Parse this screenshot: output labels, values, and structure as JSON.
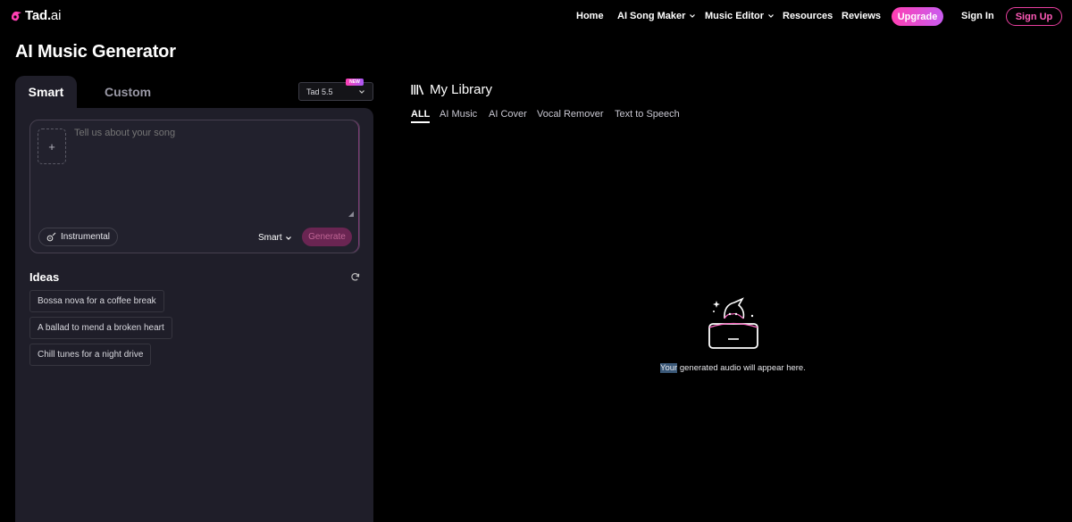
{
  "header": {
    "logo_main": "Tad.",
    "logo_ai": "ai",
    "nav": {
      "home": "Home",
      "song_maker": "AI Song Maker",
      "music_editor": "Music Editor",
      "resources": "Resources",
      "reviews": "Reviews"
    },
    "upgrade": "Upgrade",
    "sign_in": "Sign In",
    "sign_up": "Sign Up"
  },
  "page_title": "AI Music Generator",
  "generator": {
    "tabs": {
      "smart": "Smart",
      "custom": "Custom"
    },
    "model": "Tad 5.5",
    "model_badge": "NEW",
    "prompt_placeholder": "Tell us about your song",
    "upload_symbol": "+",
    "instrumental": "Instrumental",
    "mode": "Smart",
    "generate": "Generate"
  },
  "ideas": {
    "title": "Ideas",
    "items": [
      "Bossa nova for a coffee break",
      "A ballad to mend a broken heart",
      "Chill tunes for a night drive"
    ]
  },
  "library": {
    "title": "My Library",
    "tabs": [
      "ALL",
      "AI Music",
      "AI Cover",
      "Vocal Remover",
      "Text to Speech"
    ],
    "active_tab": "ALL",
    "empty_highlight": "Your",
    "empty_rest": " generated audio will appear here."
  },
  "colors": {
    "accent_pink": "#ff3fb3",
    "accent_purple": "#c95cf0",
    "panel_bg": "#1f1e29",
    "generate_bg": "#6a2552"
  },
  "icons": [
    "logo-icon",
    "chevron-down-icon",
    "plus-icon",
    "guitar-icon",
    "refresh-icon",
    "library-icon",
    "empty-box-icon"
  ]
}
